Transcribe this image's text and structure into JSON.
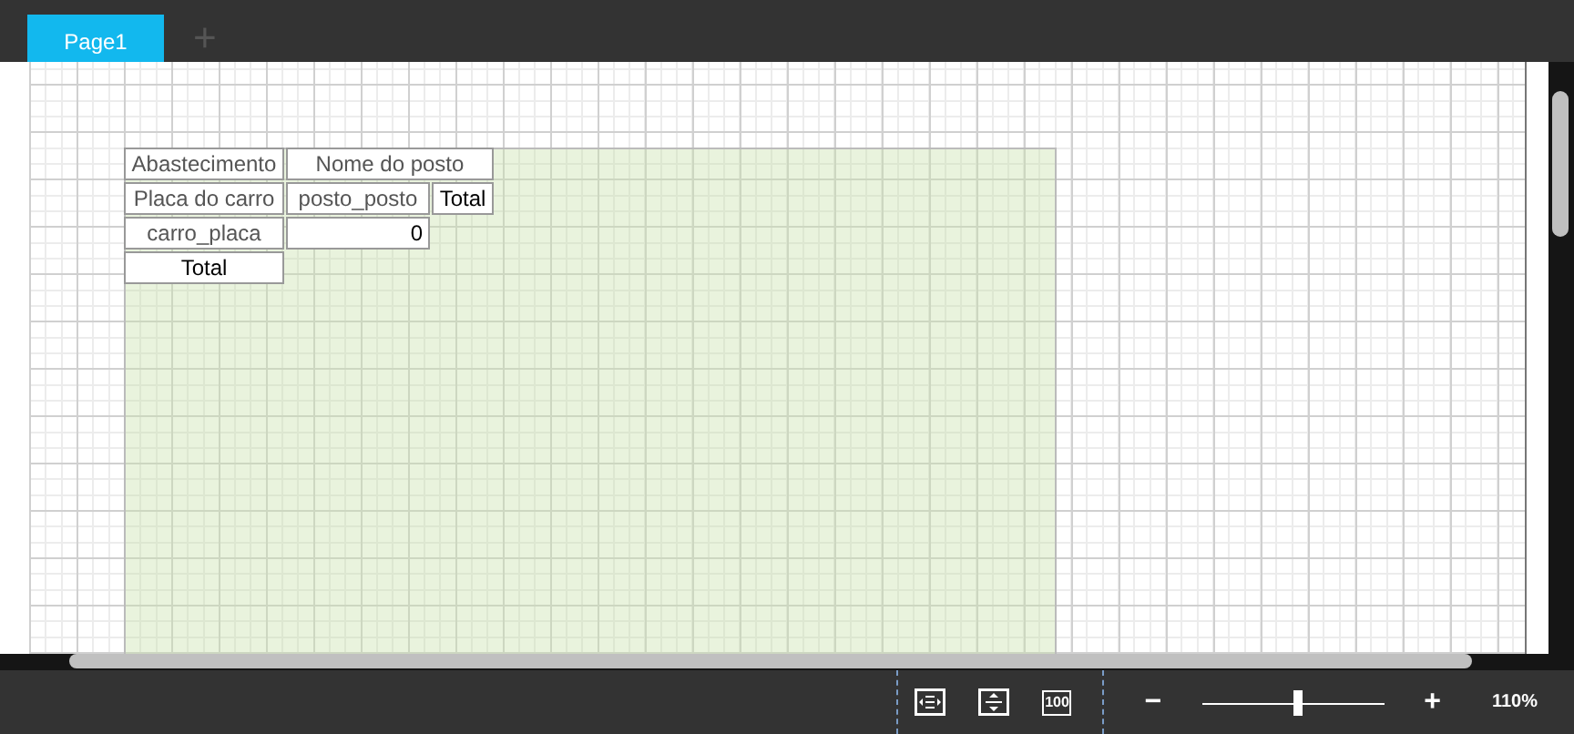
{
  "tabs": [
    {
      "label": "Page1",
      "selected": true
    }
  ],
  "add_tab": "+",
  "report": {
    "rows": [
      [
        {
          "text": "Abastecimento",
          "kind": "label"
        },
        {
          "text": "Nome do posto",
          "kind": "label"
        }
      ],
      [
        {
          "text": "Placa do carro",
          "kind": "label"
        },
        {
          "text": "posto_posto",
          "kind": "label"
        },
        {
          "text": "Total",
          "kind": "total"
        }
      ],
      [
        {
          "text": "carro_placa",
          "kind": "label"
        },
        {
          "text": "0",
          "kind": "value"
        }
      ],
      [
        {
          "text": "Total",
          "kind": "total"
        }
      ]
    ]
  },
  "toolbar": {
    "actual_size": "100",
    "zoom_out": "−",
    "zoom_in": "+",
    "zoom": {
      "level": 0.52
    },
    "zoom_reading": "110%"
  }
}
